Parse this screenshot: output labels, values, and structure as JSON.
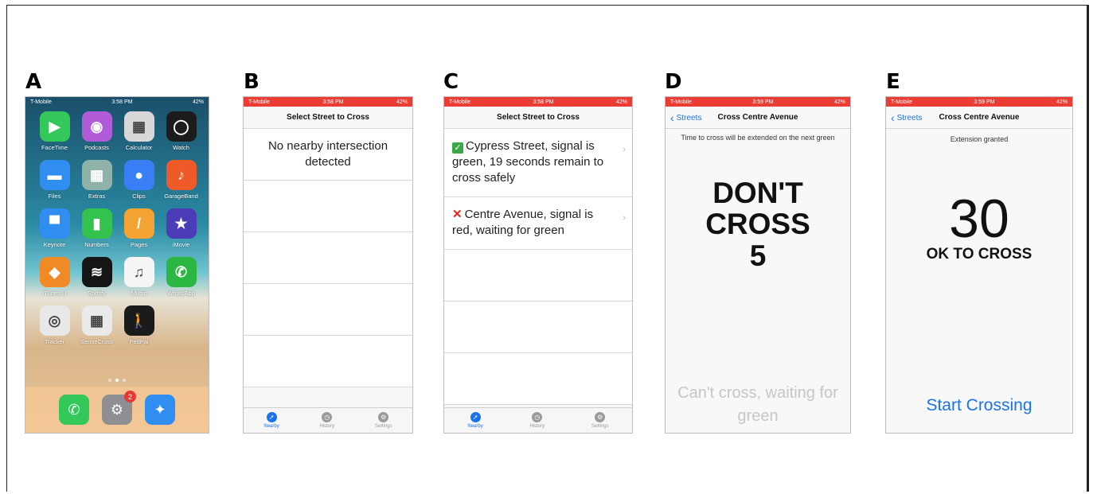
{
  "panels": {
    "a": {
      "letter": "A"
    },
    "b": {
      "letter": "B"
    },
    "c": {
      "letter": "C"
    },
    "d": {
      "letter": "D"
    },
    "e": {
      "letter": "E"
    }
  },
  "home": {
    "status": {
      "carrier": "T-Mobile",
      "time": "3:58 PM",
      "battery": "42%"
    },
    "apps": [
      {
        "name": "FaceTime",
        "icon": "facetime-icon",
        "color": "#34c759",
        "glyph": "▶"
      },
      {
        "name": "Podcasts",
        "icon": "podcasts-icon",
        "color": "#b15bd9",
        "glyph": "◉"
      },
      {
        "name": "Calculator",
        "icon": "calculator-icon",
        "color": "#d8d8d8",
        "glyph": "▦"
      },
      {
        "name": "Watch",
        "icon": "watch-icon",
        "color": "#1c1c1c",
        "glyph": "◯"
      },
      {
        "name": "Files",
        "icon": "files-icon",
        "color": "#2f8ef0",
        "glyph": "▬"
      },
      {
        "name": "Extras",
        "icon": "extras-folder-icon",
        "color": "#8fb3a8",
        "glyph": "▦"
      },
      {
        "name": "Clips",
        "icon": "clips-icon",
        "color": "#3a7ef5",
        "glyph": "●"
      },
      {
        "name": "GarageBand",
        "icon": "garageband-icon",
        "color": "#ef5a2a",
        "glyph": "♪"
      },
      {
        "name": "Keynote",
        "icon": "keynote-icon",
        "color": "#2f8ef0",
        "glyph": "▀"
      },
      {
        "name": "Numbers",
        "icon": "numbers-icon",
        "color": "#33c24d",
        "glyph": "▮"
      },
      {
        "name": "Pages",
        "icon": "pages-icon",
        "color": "#f2a332",
        "glyph": "/"
      },
      {
        "name": "iMovie",
        "icon": "imovie-icon",
        "color": "#4b3cb8",
        "glyph": "★"
      },
      {
        "name": "iTunes U",
        "icon": "itunes-u-icon",
        "color": "#f08a24",
        "glyph": "◆"
      },
      {
        "name": "Spotify",
        "icon": "spotify-icon",
        "color": "#151515",
        "glyph": "≋"
      },
      {
        "name": "Music",
        "icon": "music-icon",
        "color": "#f5f5f5",
        "glyph": "♫"
      },
      {
        "name": "WhatsApp",
        "icon": "whatsapp-icon",
        "color": "#2bb741",
        "glyph": "✆"
      },
      {
        "name": "Tracker",
        "icon": "tracker-icon",
        "color": "#e8e8e8",
        "glyph": "◎"
      },
      {
        "name": "SenseCross",
        "icon": "sensecross-icon",
        "color": "#eaeaea",
        "glyph": "▦"
      },
      {
        "name": "PedPal",
        "icon": "pedpal-icon",
        "color": "#1b1b1b",
        "glyph": "🚶"
      }
    ],
    "dock": [
      {
        "icon": "phone-icon",
        "color": "#34c759",
        "glyph": "✆"
      },
      {
        "icon": "settings-icon",
        "color": "#8e8e93",
        "glyph": "⚙",
        "badge": "2"
      },
      {
        "icon": "safari-icon",
        "color": "#2f8ef0",
        "glyph": "✦"
      }
    ]
  },
  "app_status": {
    "carrier": "T-Mobile",
    "time_b": "3:58 PM",
    "time_c": "3:58 PM",
    "time_d": "3:59 PM",
    "time_e": "3:59 PM",
    "battery": "42%"
  },
  "screen_b": {
    "title": "Select Street to Cross",
    "message": "No nearby intersection detected"
  },
  "screen_c": {
    "title": "Select Street to Cross",
    "rows": [
      {
        "status": "green",
        "text": "Cypress Street, signal is green, 19 seconds remain to cross safely"
      },
      {
        "status": "red",
        "text": "Centre Avenue, signal is red, waiting for green"
      }
    ]
  },
  "tabs": [
    {
      "label": "Nearby",
      "icon": "compass-icon",
      "glyph": "➚"
    },
    {
      "label": "History",
      "icon": "clock-icon",
      "glyph": "◷"
    },
    {
      "label": "Settings",
      "icon": "gear-icon",
      "glyph": "⚙"
    }
  ],
  "screen_d": {
    "back": "Streets",
    "title": "Cross Centre Avenue",
    "note": "Time to cross will be extended on the next green",
    "status_line1": "DON'T",
    "status_line2": "CROSS",
    "countdown": "5",
    "footer": "Can't cross, waiting for green"
  },
  "screen_e": {
    "back": "Streets",
    "title": "Cross Centre Avenue",
    "note": "Extension granted",
    "countdown": "30",
    "status": "OK TO CROSS",
    "button": "Start Crossing"
  },
  "colors": {
    "status_red": "#ec3d35",
    "ios_blue": "#1a73e8",
    "check_green": "#3aa846",
    "cross_red": "#e0251b"
  }
}
